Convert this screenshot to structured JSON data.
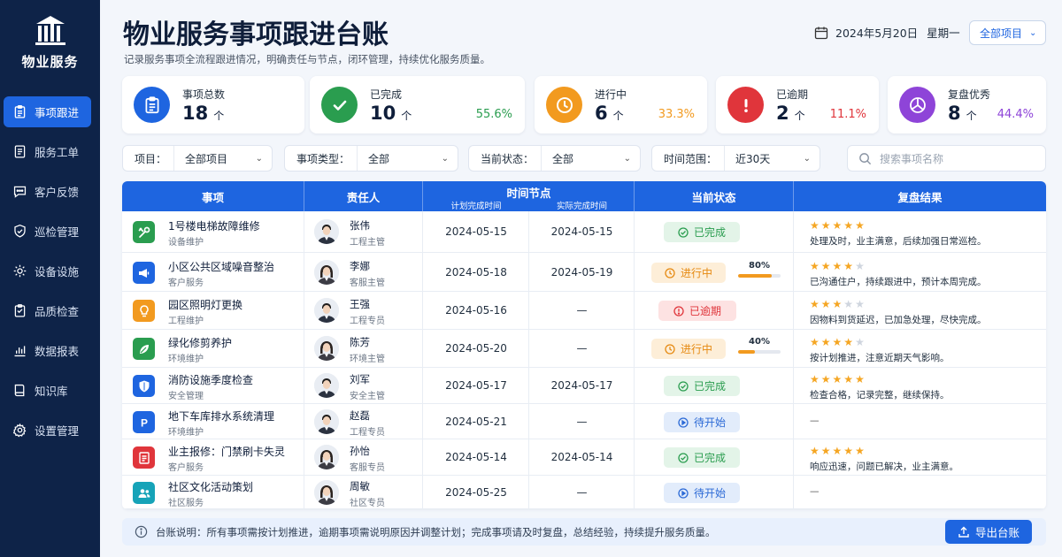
{
  "sidebar": {
    "logo_text": "物业服务",
    "items": [
      {
        "label": "事项跟进",
        "icon": "clipboard-icon",
        "active": true
      },
      {
        "label": "服务工单",
        "icon": "document-list-icon",
        "active": false
      },
      {
        "label": "客户反馈",
        "icon": "chat-bubble-icon",
        "active": false
      },
      {
        "label": "巡检管理",
        "icon": "shield-check-icon",
        "active": false
      },
      {
        "label": "设备设施",
        "icon": "gear-icon",
        "active": false
      },
      {
        "label": "品质检查",
        "icon": "checklist-icon",
        "active": false
      },
      {
        "label": "数据报表",
        "icon": "bar-chart-icon",
        "active": false
      },
      {
        "label": "知识库",
        "icon": "book-icon",
        "active": false
      },
      {
        "label": "设置管理",
        "icon": "settings-icon",
        "active": false
      }
    ]
  },
  "header": {
    "title": "物业服务事项跟进台账",
    "subtitle": "记录服务事项全流程跟进情况，明确责任与节点，闭环管理，持续优化服务质量。",
    "date": "2024年5月20日",
    "weekday": "星期一",
    "project_select": "全部项目"
  },
  "stats": [
    {
      "label": "事项总数",
      "value": "18",
      "unit": "个",
      "percent": "",
      "color": "#1e65e0",
      "icon": "clipboard-icon"
    },
    {
      "label": "已完成",
      "value": "10",
      "unit": "个",
      "percent": "55.6%",
      "color": "#2a9d4f",
      "icon": "check-icon"
    },
    {
      "label": "进行中",
      "value": "6",
      "unit": "个",
      "percent": "33.3%",
      "color": "#f29a1f",
      "icon": "clock-icon"
    },
    {
      "label": "已逾期",
      "value": "2",
      "unit": "个",
      "percent": "11.1%",
      "color": "#e0353b",
      "icon": "alert-icon"
    },
    {
      "label": "复盘优秀",
      "value": "8",
      "unit": "个",
      "percent": "44.4%",
      "color": "#8e44d8",
      "icon": "pie-chart-icon"
    }
  ],
  "filters": [
    {
      "label": "项目：",
      "value": "全部项目"
    },
    {
      "label": "事项类型：",
      "value": "全部"
    },
    {
      "label": "当前状态：",
      "value": "全部"
    },
    {
      "label": "时间范围：",
      "value": "近30天"
    }
  ],
  "search": {
    "placeholder": "搜索事项名称"
  },
  "table": {
    "headers": {
      "item": "事项",
      "owner": "责任人",
      "time": "时间节点",
      "planned": "计划完成时间",
      "actual": "实际完成时间",
      "status": "当前状态",
      "review": "复盘结果"
    },
    "rows": [
      {
        "name": "1号楼电梯故障维修",
        "category": "设备维护",
        "icon": "wrench-icon",
        "icon_color": "#2a9d4f",
        "person": "张伟",
        "role": "工程主管",
        "gender": "m",
        "planned": "2024-05-15",
        "actual": "2024-05-15",
        "status": "已完成",
        "status_type": "done",
        "progress": null,
        "progress_text": "",
        "stars": 5,
        "review": "处理及时，业主满意，后续加强日常巡检。"
      },
      {
        "name": "小区公共区域噪音整治",
        "category": "客户服务",
        "icon": "megaphone-icon",
        "icon_color": "#1e65e0",
        "person": "李娜",
        "role": "客服主管",
        "gender": "f",
        "planned": "2024-05-18",
        "actual": "2024-05-19",
        "status": "进行中",
        "status_type": "prog",
        "progress": 0.8,
        "progress_text": "80%",
        "stars": 4,
        "review": "已沟通住户，持续跟进中，预计本周完成。"
      },
      {
        "name": "园区照明灯更换",
        "category": "工程维护",
        "icon": "lightbulb-icon",
        "icon_color": "#f29a1f",
        "person": "王强",
        "role": "工程专员",
        "gender": "m",
        "planned": "2024-05-16",
        "actual": "—",
        "status": "已逾期",
        "status_type": "over",
        "progress": null,
        "progress_text": "",
        "stars": 3,
        "review": "因物料到货延迟，已加急处理，尽快完成。"
      },
      {
        "name": "绿化修剪养护",
        "category": "环境维护",
        "icon": "leaf-icon",
        "icon_color": "#2a9d4f",
        "person": "陈芳",
        "role": "环境主管",
        "gender": "f",
        "planned": "2024-05-20",
        "actual": "—",
        "status": "进行中",
        "status_type": "prog",
        "progress": 0.4,
        "progress_text": "40%",
        "stars": 4,
        "review": "按计划推进，注意近期天气影响。"
      },
      {
        "name": "消防设施季度检查",
        "category": "安全管理",
        "icon": "shield-icon",
        "icon_color": "#1e65e0",
        "person": "刘军",
        "role": "安全主管",
        "gender": "m",
        "planned": "2024-05-17",
        "actual": "2024-05-17",
        "status": "已完成",
        "status_type": "done",
        "progress": null,
        "progress_text": "",
        "stars": 5,
        "review": "检查合格，记录完整，继续保持。"
      },
      {
        "name": "地下车库排水系统清理",
        "category": "环境维护",
        "icon": "parking-icon",
        "icon_color": "#1e65e0",
        "person": "赵磊",
        "role": "工程专员",
        "gender": "m",
        "planned": "2024-05-21",
        "actual": "—",
        "status": "待开始",
        "status_type": "wait",
        "progress": null,
        "progress_text": "",
        "stars": 0,
        "review": "—"
      },
      {
        "name": "业主报修：门禁刷卡失灵",
        "category": "客户服务",
        "icon": "form-icon",
        "icon_color": "#e0353b",
        "person": "孙怡",
        "role": "客服专员",
        "gender": "f",
        "planned": "2024-05-14",
        "actual": "2024-05-14",
        "status": "已完成",
        "status_type": "done",
        "progress": null,
        "progress_text": "",
        "stars": 5,
        "review": "响应迅速，问题已解决，业主满意。"
      },
      {
        "name": "社区文化活动策划",
        "category": "社区服务",
        "icon": "people-icon",
        "icon_color": "#16a3b8",
        "person": "周敏",
        "role": "社区专员",
        "gender": "f",
        "planned": "2024-05-25",
        "actual": "—",
        "status": "待开始",
        "status_type": "wait",
        "progress": null,
        "progress_text": "",
        "stars": 0,
        "review": "—"
      }
    ]
  },
  "footer": {
    "note": "台账说明：所有事项需按计划推进，逾期事项需说明原因并调整计划；完成事项请及时复盘，总结经验，持续提升服务质量。",
    "export_label": "导出台账"
  }
}
